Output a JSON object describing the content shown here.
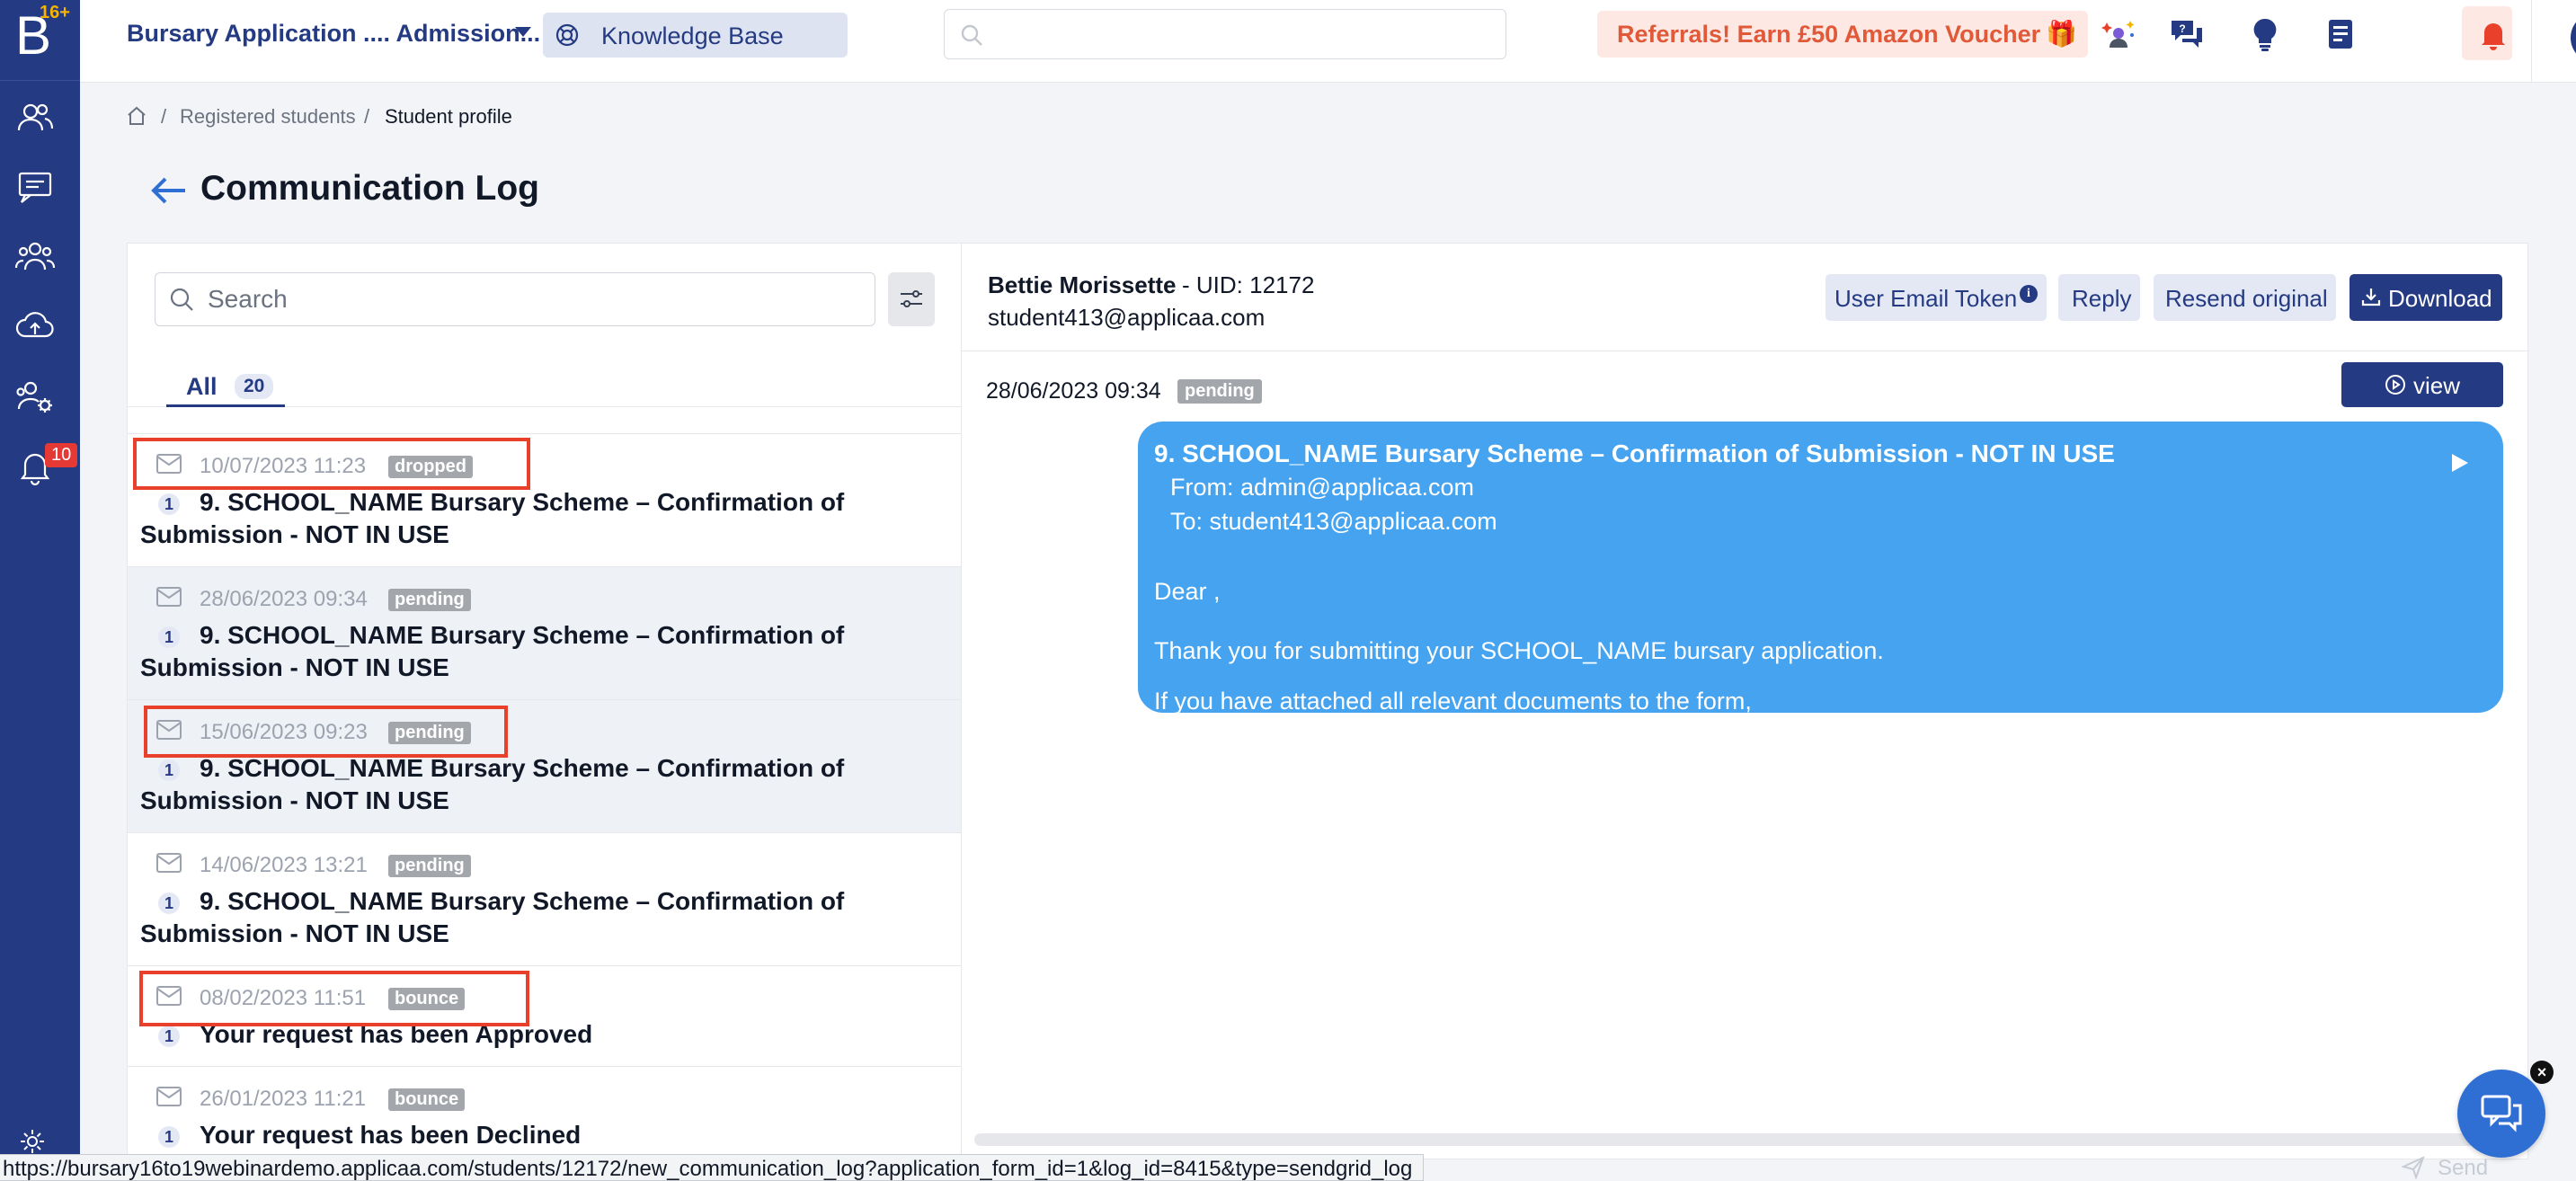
{
  "sidebar": {
    "logo_letter": "B",
    "logo_badge": "16+",
    "items": [
      {
        "icon": "users-icon"
      },
      {
        "icon": "messages-icon"
      },
      {
        "icon": "groups-icon"
      },
      {
        "icon": "upload-cloud-icon"
      },
      {
        "icon": "user-settings-icon"
      },
      {
        "icon": "bell-icon",
        "badge": "10"
      }
    ]
  },
  "topbar": {
    "app_title": "Bursary Application .... Admission...",
    "knowledge_base": "Knowledge Base",
    "search_placeholder": "",
    "referral": "Referrals! Earn £50 Amazon Voucher",
    "referral_icon": "🎁",
    "icons": [
      "ai-sparkle-icon",
      "chat-bubbles-icon",
      "lightbulb-icon",
      "document-icon",
      "bell-alert-icon",
      "user-avatar-icon"
    ]
  },
  "breadcrumb": {
    "items": [
      "Registered students",
      "Student profile"
    ],
    "separator": "/"
  },
  "page": {
    "title": "Communication Log"
  },
  "left": {
    "search_placeholder": "Search",
    "tab": {
      "label": "All",
      "count": "20"
    },
    "logs": [
      {
        "date": "10/07/2023 11:23",
        "status": "dropped",
        "num": "1",
        "subject": "9. SCHOOL_NAME Bursary Scheme – Confirmation of Submission - NOT IN USE",
        "highlighted": true,
        "selected": false
      },
      {
        "date": "28/06/2023 09:34",
        "status": "pending",
        "num": "1",
        "subject": "9. SCHOOL_NAME Bursary Scheme – Confirmation of Submission - NOT IN USE",
        "highlighted": false,
        "selected": true
      },
      {
        "date": "15/06/2023 09:23",
        "status": "pending",
        "num": "1",
        "subject": "9. SCHOOL_NAME Bursary Scheme – Confirmation of Submission - NOT IN USE",
        "highlighted": true,
        "selected": true
      },
      {
        "date": "14/06/2023 13:21",
        "status": "pending",
        "num": "1",
        "subject": "9. SCHOOL_NAME Bursary Scheme – Confirmation of Submission - NOT IN USE",
        "highlighted": false,
        "selected": false
      },
      {
        "date": "08/02/2023 11:51",
        "status": "bounce",
        "num": "1",
        "subject": "Your request has been Approved",
        "highlighted": true,
        "selected": false
      },
      {
        "date": "26/01/2023 11:21",
        "status": "bounce",
        "num": "1",
        "subject": "Your request has been Declined",
        "highlighted": false,
        "selected": false
      }
    ]
  },
  "right": {
    "name": "Bettie Morissette",
    "uid": "- UID: 12172",
    "email": "student413@applicaa.com",
    "buttons": {
      "token": "User Email Token",
      "info": "i",
      "reply": "Reply",
      "resend": "Resend original",
      "download": "Download"
    },
    "message": {
      "date": "28/06/2023 09:34",
      "status": "pending",
      "view": "view",
      "subject": "9. SCHOOL_NAME Bursary Scheme – Confirmation of Submission - NOT IN USE",
      "from": "From: admin@applicaa.com",
      "to": "To: student413@applicaa.com",
      "greeting": "Dear ,",
      "body1": "Thank you for submitting your SCHOOL_NAME bursary application.",
      "body2": "If you have attached all relevant documents to the form,"
    }
  },
  "statusbar": {
    "url": "https://bursary16to19webinardemo.applicaa.com/students/12172/new_communication_log?application_form_id=1&log_id=8415&type=sendgrid_log"
  },
  "chat": {
    "send": "Send",
    "close": "×"
  },
  "colors": {
    "sidebar": "#243a82",
    "accent": "#243a82",
    "bubble": "#45a3f0",
    "highlight": "#e8402a",
    "status_badge": "#a3a6ab",
    "referral_text": "#e05a3a"
  }
}
